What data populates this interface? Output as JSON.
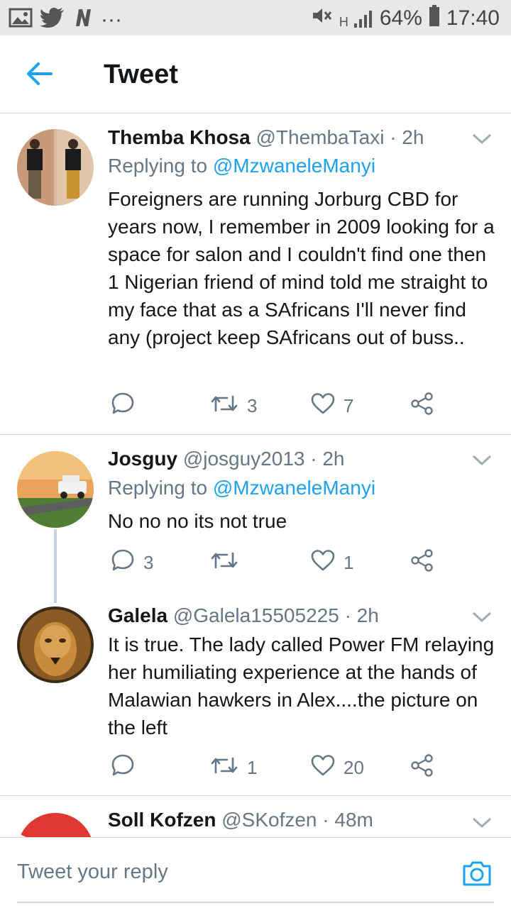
{
  "status_bar": {
    "battery": "64%",
    "time": "17:40",
    "signal_label": "H",
    "more": "···",
    "icons": [
      "image-icon",
      "twitter-icon",
      "n-icon",
      "mute-icon",
      "signal-icon",
      "battery-icon"
    ]
  },
  "app_bar": {
    "title": "Tweet",
    "back_icon": "back-arrow-icon"
  },
  "tweets": [
    {
      "name": "Themba Khosa",
      "handle": "@ThembaTaxi · 2h",
      "reply_prefix": "Replying to ",
      "reply_to": "@MzwaneleManyi",
      "text": "Foreigners are running Jorburg CBD for years now, I remember in 2009 looking for a space for salon  and I couldn't find one then 1 Nigerian friend of mind told me straight to my face that as a SAfricans I'll never find any (project keep SAfricans out of buss..",
      "replies": "",
      "retweets": "3",
      "likes": "7"
    },
    {
      "name": "Josguy",
      "handle": "@josguy2013 · 2h",
      "reply_prefix": "Replying to ",
      "reply_to": "@MzwaneleManyi",
      "text": "No no no its not true",
      "replies": "3",
      "retweets": "",
      "likes": "1"
    },
    {
      "name": "Galela",
      "handle": "@Galela15505225 · 2h",
      "text": "It is true. The lady called Power FM relaying her humiliating experience at the hands of Malawian hawkers in Alex....the picture on the left",
      "replies": "",
      "retweets": "1",
      "likes": "20"
    },
    {
      "name": "Soll Kofzen",
      "handle": "@SKofzen · 48m"
    }
  ],
  "composer": {
    "placeholder": "Tweet your reply",
    "camera_icon": "camera-icon"
  },
  "colors": {
    "accent": "#1da1f2",
    "text": "#14171a",
    "muted": "#657786",
    "status_bar": "#e8e8e8"
  }
}
